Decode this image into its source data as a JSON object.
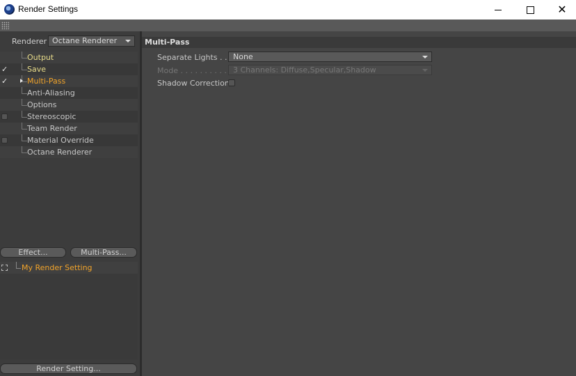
{
  "window": {
    "title": "Render Settings",
    "icon": "cinema4d-icon"
  },
  "window_controls": {
    "minimize": "minimize-icon",
    "maximize": "maximize-icon",
    "close": "close-icon",
    "close_glyph": "✕"
  },
  "renderer": {
    "label": "Renderer",
    "value": "Octane Renderer"
  },
  "tree": [
    {
      "label": "Output",
      "check": "none",
      "style": "yellow"
    },
    {
      "label": "Save",
      "check": "checked",
      "style": "yellow"
    },
    {
      "label": "Multi-Pass",
      "check": "checked",
      "style": "orange",
      "expandable": true
    },
    {
      "label": "Anti-Aliasing",
      "check": "none",
      "style": "normal"
    },
    {
      "label": "Options",
      "check": "none",
      "style": "normal"
    },
    {
      "label": "Stereoscopic",
      "check": "box",
      "style": "normal"
    },
    {
      "label": "Team Render",
      "check": "none",
      "style": "normal"
    },
    {
      "label": "Material Override",
      "check": "box",
      "style": "normal"
    },
    {
      "label": "Octane Renderer",
      "check": "none",
      "style": "normal"
    }
  ],
  "check_glyph": "✓",
  "buttons": {
    "effect": "Effect...",
    "multipass": "Multi-Pass...",
    "render_setting": "Render Setting..."
  },
  "settings_list": [
    {
      "label": "My Render Setting",
      "icon": "expand-icon"
    }
  ],
  "panel": {
    "title": "Multi-Pass",
    "separate_lights": {
      "label": "Separate Lights . . .",
      "value": "None"
    },
    "mode": {
      "label": "Mode . . . . . . . . . . .",
      "value": "3 Channels: Diffuse,Specular,Shadow"
    },
    "shadow_correction": {
      "label": "Shadow Correction"
    }
  },
  "colors": {
    "active_orange": "#f2a42a",
    "item_yellow": "#e8dc8a",
    "panel_bg": "#454545"
  }
}
